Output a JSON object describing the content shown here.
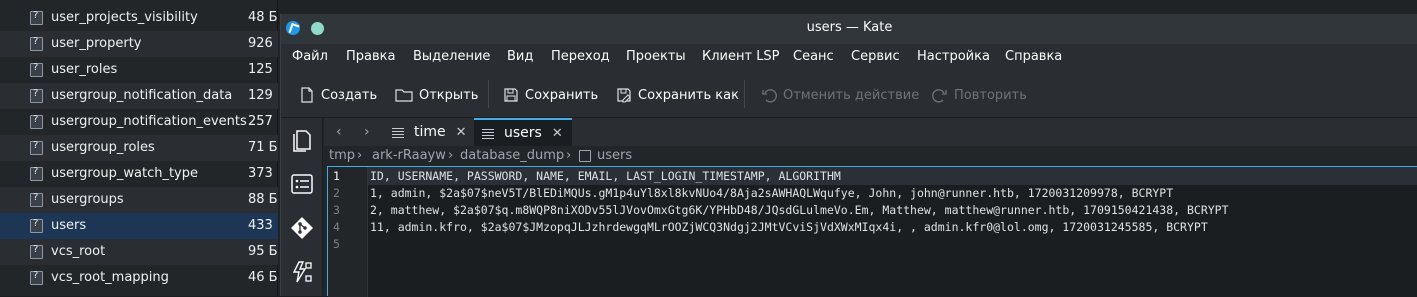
{
  "file_manager": {
    "rows": [
      {
        "name": "user_projects_visibility",
        "size": "48 Б"
      },
      {
        "name": "user_property",
        "size": "926 Б"
      },
      {
        "name": "user_roles",
        "size": "125 Б"
      },
      {
        "name": "usergroup_notification_data",
        "size": "129 Б"
      },
      {
        "name": "usergroup_notification_events",
        "size": "257 Б"
      },
      {
        "name": "usergroup_roles",
        "size": "71 Б"
      },
      {
        "name": "usergroup_watch_type",
        "size": "373 Б"
      },
      {
        "name": "usergroups",
        "size": "88 Б"
      },
      {
        "name": "users",
        "size": "433 Б"
      },
      {
        "name": "vcs_root",
        "size": "95 Б"
      },
      {
        "name": "vcs_root_mapping",
        "size": "46 Б"
      }
    ],
    "selected": "users",
    "file_icon": "unknown-file-icon"
  },
  "window": {
    "title": "users — Kate"
  },
  "menu": [
    "Файл",
    "Правка",
    "Выделение",
    "Вид",
    "Переход",
    "Проекты",
    "Клиент LSP",
    "Сеанс",
    "Сервис",
    "Настройка",
    "Справка"
  ],
  "toolbar": {
    "new": "Создать",
    "open": "Открыть",
    "save": "Сохранить",
    "save_as": "Сохранить как",
    "undo": "Отменить действие",
    "redo": "Повторить"
  },
  "tabs": [
    {
      "label": "time",
      "active": false
    },
    {
      "label": "users",
      "active": true
    }
  ],
  "breadcrumb": [
    "tmp",
    "ark-rRaayw",
    "database_dump",
    "users"
  ],
  "editor": {
    "line_numbers": [
      "1",
      "2",
      "3",
      "4",
      "5"
    ],
    "lines": [
      "ID, USERNAME, PASSWORD, NAME, EMAIL, LAST_LOGIN_TIMESTAMP, ALGORITHM",
      "1, admin, $2a$07$neV5T/BlEDiMQUs.gM1p4uYl8xl8kvNUo4/8Aja2sAWHAQLWqufye, John, john@runner.htb, 1720031209978, BCRYPT",
      "2, matthew, $2a$07$q.m8WQP8niXODv55lJVovOmxGtg6K/YPHbD48/JQsdGLulmeVo.Em, Matthew, matthew@runner.htb, 1709150421438, BCRYPT",
      "11, admin.kfro, $2a$07$JMzopqJLJzhrdewgqMLrOOZjWCQ3Ndgj2JMtVCviSjVdXWxMIqx4i, , admin.kfr0@lol.omg, 1720031245585, BCRYPT",
      ""
    ]
  },
  "colors": {
    "accent": "#3daee9",
    "selection": "#1e3656"
  }
}
